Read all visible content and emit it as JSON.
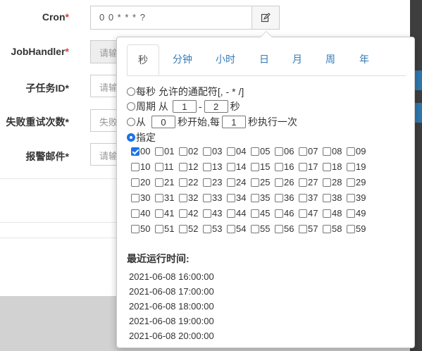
{
  "form": {
    "cron_label": "Cron",
    "cron_value": "0 0 * * * ?",
    "jobhandler_label": "JobHandler",
    "jobhandler_placeholder": "请输",
    "child_label": "子任务ID*",
    "child_placeholder": "请输",
    "retry_label": "失败重试次数*",
    "retry_placeholder": "失败",
    "alarm_label": "报警邮件*",
    "alarm_placeholder": "请输",
    "required_mark": "*"
  },
  "colors": {
    "accent": "#1a73e8",
    "tab_link": "#337ab7",
    "required": "#e03c3c"
  },
  "icons": {
    "cron_button": "edit-icon"
  },
  "popover": {
    "tabs": [
      "秒",
      "分钟",
      "小时",
      "日",
      "月",
      "周",
      "年"
    ],
    "active_tab": 0,
    "options": {
      "every": "每秒 允许的通配符[, - * /]",
      "cycle_prefix": "周期 从",
      "cycle_from": "1",
      "cycle_dash": "-",
      "cycle_to": "2",
      "cycle_suffix": "秒",
      "start_prefix": "从",
      "start_value": "0",
      "start_mid": "秒开始,每",
      "start_step": "1",
      "start_suffix": "秒执行一次",
      "specify": "指定"
    },
    "selected_option": "specify",
    "seconds": [
      "00",
      "01",
      "02",
      "03",
      "04",
      "05",
      "06",
      "07",
      "08",
      "09",
      "10",
      "11",
      "12",
      "13",
      "14",
      "15",
      "16",
      "17",
      "18",
      "19",
      "20",
      "21",
      "22",
      "23",
      "24",
      "25",
      "26",
      "27",
      "28",
      "29",
      "30",
      "31",
      "32",
      "33",
      "34",
      "35",
      "36",
      "37",
      "38",
      "39",
      "40",
      "41",
      "42",
      "43",
      "44",
      "45",
      "46",
      "47",
      "48",
      "49",
      "50",
      "51",
      "52",
      "53",
      "54",
      "55",
      "56",
      "57",
      "58",
      "59"
    ],
    "checked_seconds": [
      "00"
    ],
    "recent_title": "最近运行时间:",
    "recent_runs": [
      "2021-06-08 16:00:00",
      "2021-06-08 17:00:00",
      "2021-06-08 18:00:00",
      "2021-06-08 19:00:00",
      "2021-06-08 20:00:00"
    ]
  }
}
